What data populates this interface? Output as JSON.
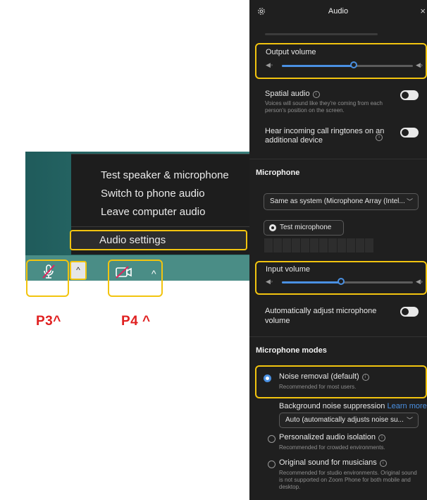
{
  "menu": {
    "items": [
      "Test speaker & microphone",
      "Switch to phone audio",
      "Leave computer audio"
    ],
    "settings_label": "Audio settings"
  },
  "toolbar": {
    "audio_label": "Audio",
    "video_label": "Video"
  },
  "tags": {
    "p3": "P3^",
    "p4": "P4 ^"
  },
  "panel": {
    "title": "Audio",
    "close": "×",
    "output_volume": {
      "label": "Output volume",
      "level": 0.55
    },
    "spatial": {
      "label": "Spatial audio",
      "desc": "Voices will sound like they're coming from each person's position on the screen."
    },
    "ringtones": {
      "label": "Hear incoming call ringtones on an additional device"
    },
    "microphone": {
      "heading": "Microphone",
      "device": "Same as system (Microphone Array (Intel...",
      "test_label": "Test microphone"
    },
    "input_volume": {
      "label": "Input volume",
      "level": 0.45
    },
    "auto_adjust": {
      "label": "Automatically adjust microphone volume"
    },
    "modes": {
      "heading": "Microphone modes",
      "noise": {
        "label": "Noise removal (default)",
        "desc": "Recommended for most users."
      },
      "bg_suppression": {
        "label": "Background noise suppression",
        "link": "Learn more"
      },
      "bg_value": "Auto (automatically adjusts noise su...",
      "personalized": {
        "label": "Personalized audio isolation",
        "desc": "Recommended for crowded environments."
      },
      "original": {
        "label": "Original sound for musicians",
        "desc": "Recommended for studio environments. Original sound is not supported on Zoom Phone for both mobile and desktop."
      }
    }
  },
  "colors": {
    "highlight": "#f2c40f",
    "accent": "#4a90e2",
    "tag": "#e02020"
  }
}
